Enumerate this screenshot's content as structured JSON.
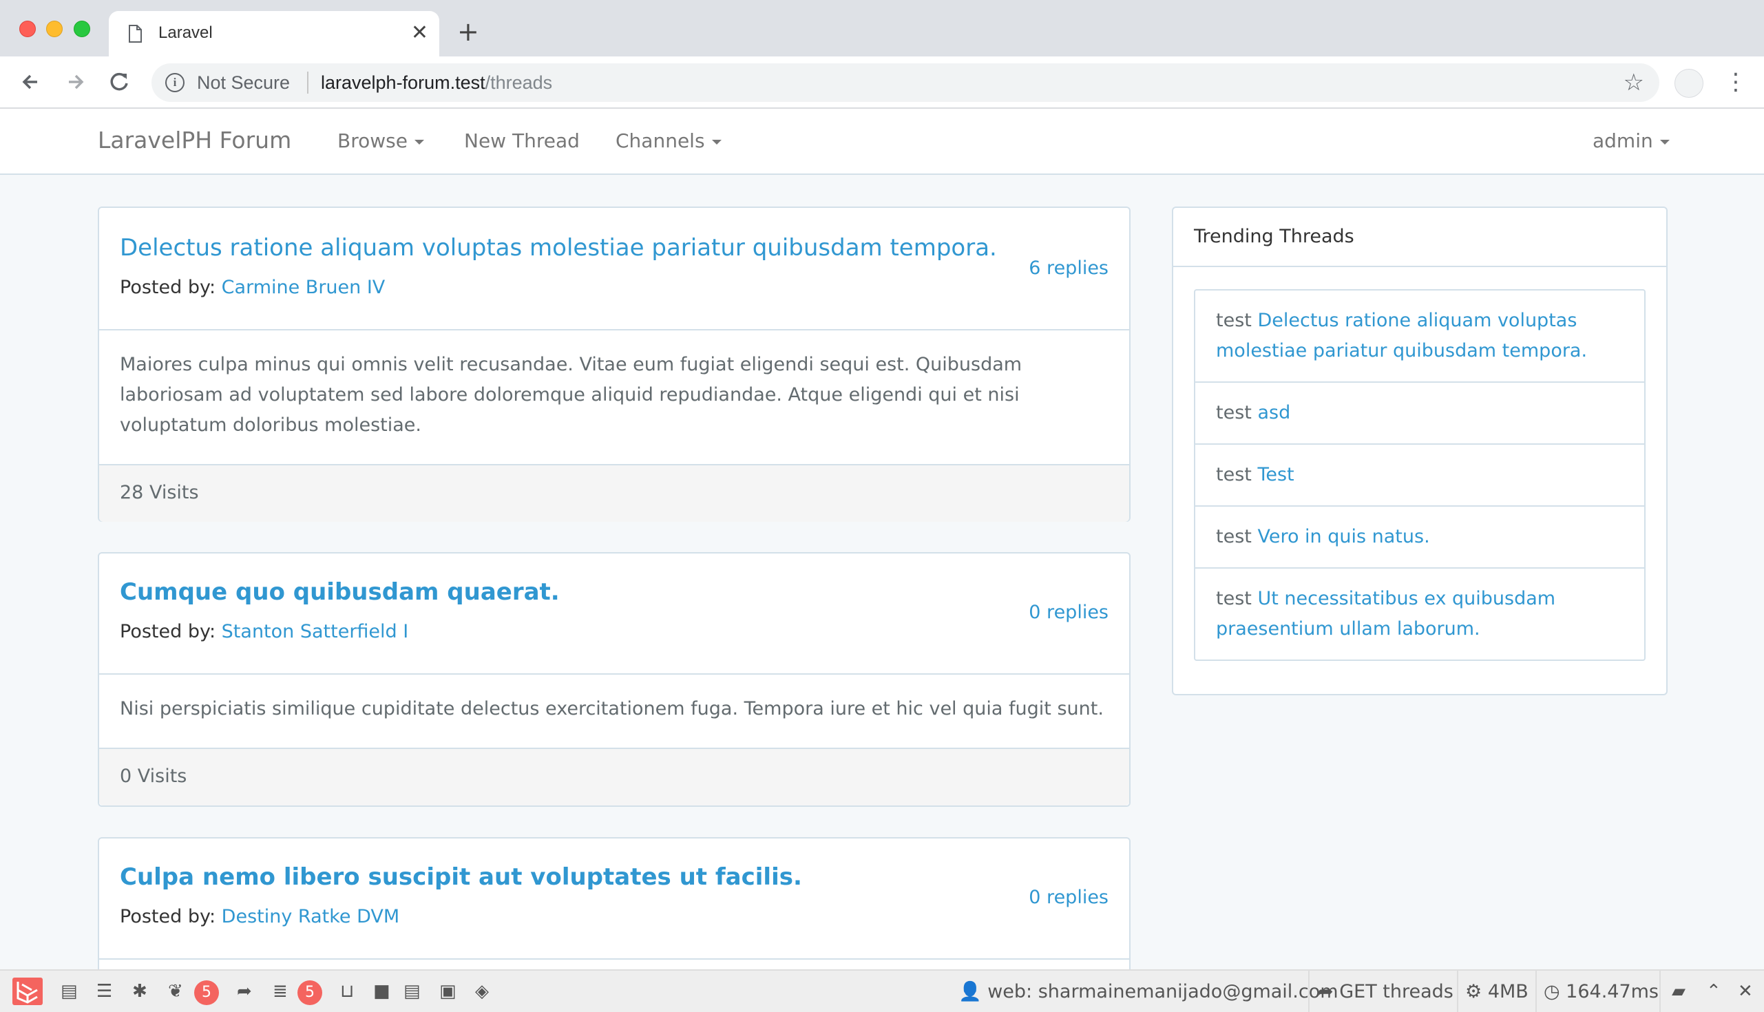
{
  "browser": {
    "tab_title": "Laravel",
    "tab_close": "✕",
    "new_tab": "+",
    "not_secure": "Not Secure",
    "url_host": "laravelph-forum.test",
    "url_path": "/threads"
  },
  "navbar": {
    "brand": "LaravelPH Forum",
    "browse": "Browse",
    "new_thread": "New Thread",
    "channels": "Channels",
    "user": "admin"
  },
  "threads": [
    {
      "title": "Delectus ratione aliquam voluptas molestiae pariatur quibusdam tempora.",
      "posted_label": "Posted by:",
      "author": "Carmine Bruen IV",
      "replies": "6 replies",
      "body": "Maiores culpa minus qui omnis velit recusandae. Vitae eum fugiat eligendi sequi est. Quibusdam laboriosam ad voluptatem sed labore doloremque aliquid repudiandae. Atque eligendi qui et nisi voluptatum doloribus molestiae.",
      "visits": "28 Visits"
    },
    {
      "title": "Cumque quo quibusdam quaerat.",
      "posted_label": "Posted by:",
      "author": "Stanton Satterfield I",
      "replies": "0 replies",
      "body": "Nisi perspiciatis similique cupiditate delectus exercitationem fuga. Tempora iure et hic vel quia fugit sunt.",
      "visits": "0 Visits"
    },
    {
      "title": "Culpa nemo libero suscipit aut voluptates ut facilis.",
      "posted_label": "Posted by:",
      "author": "Destiny Ratke DVM",
      "replies": "0 replies"
    }
  ],
  "sidebar": {
    "title": "Trending Threads",
    "items": [
      {
        "prefix": "test",
        "title": "Delectus ratione aliquam voluptas molestiae pariatur quibusdam tempora."
      },
      {
        "prefix": "test",
        "title": "asd"
      },
      {
        "prefix": "test",
        "title": "Test"
      },
      {
        "prefix": "test",
        "title": "Vero in quis natus."
      },
      {
        "prefix": "test",
        "title": "Ut necessitatibus ex quibusdam praesentium ullam laborum."
      }
    ]
  },
  "debugbar": {
    "messages_count": "5",
    "queries_count": "5",
    "user": "web: sharmainemanijado@gmail.com",
    "request": "GET threads",
    "memory": "4MB",
    "time": "164.47ms"
  },
  "colors": {
    "link": "#3097d1",
    "text": "#636b6f",
    "border": "#d3e0e9",
    "background": "#f5f8fa",
    "debugbar_accent": "#f4645f"
  }
}
